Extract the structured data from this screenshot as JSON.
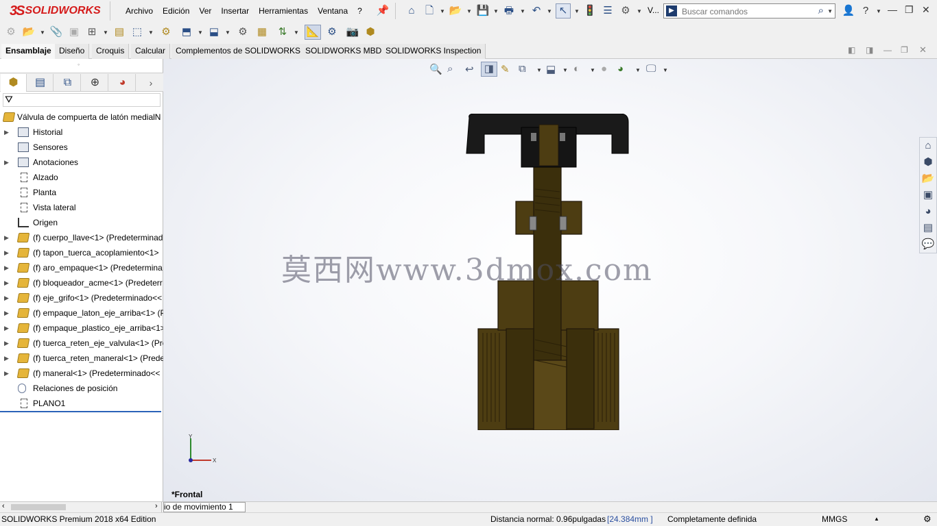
{
  "app": {
    "logo_ds": "3S",
    "logo_text": "SOLIDWORKS",
    "menu": [
      "Archivo",
      "Edición",
      "Ver",
      "Insertar",
      "Herramientas",
      "Ventana",
      "?"
    ],
    "view_menu_short": "V...",
    "search_placeholder": "Buscar comandos"
  },
  "tabs": [
    "Ensamblaje",
    "Diseño",
    "Croquis",
    "Calcular",
    "Complementos de SOLIDWORKS",
    "SOLIDWORKS MBD",
    "SOLIDWORKS Inspection"
  ],
  "active_tab": "Ensamblaje",
  "tree": {
    "root": "Válvula de compuerta de latón medialN",
    "items": [
      {
        "label": "Historial",
        "icon": "history-folder-icon",
        "expandable": true
      },
      {
        "label": "Sensores",
        "icon": "sensor-folder-icon",
        "expandable": false
      },
      {
        "label": "Anotaciones",
        "icon": "annotations-icon",
        "expandable": true
      },
      {
        "label": "Alzado",
        "icon": "plane-icon",
        "expandable": false
      },
      {
        "label": "Planta",
        "icon": "plane-icon",
        "expandable": false
      },
      {
        "label": "Vista lateral",
        "icon": "plane-icon",
        "expandable": false
      },
      {
        "label": "Origen",
        "icon": "origin-icon",
        "expandable": false
      },
      {
        "label": "(f) cuerpo_llave<1> (Predeterminad",
        "icon": "part-icon",
        "expandable": true
      },
      {
        "label": "(f) tapon_tuerca_acoplamiento<1>",
        "icon": "part-icon",
        "expandable": true
      },
      {
        "label": "(f) aro_empaque<1> (Predetermina",
        "icon": "part-icon",
        "expandable": true
      },
      {
        "label": "(f) bloqueador_acme<1> (Predeterr",
        "icon": "part-icon",
        "expandable": true
      },
      {
        "label": "(f) eje_grifo<1> (Predeterminado<<",
        "icon": "part-icon",
        "expandable": true
      },
      {
        "label": "(f) empaque_laton_eje_arriba<1> (P",
        "icon": "part-icon",
        "expandable": true
      },
      {
        "label": "(f) empaque_plastico_eje_arriba<1>",
        "icon": "part-icon",
        "expandable": true
      },
      {
        "label": "(f) tuerca_reten_eje_valvula<1> (Pre",
        "icon": "part-icon",
        "expandable": true
      },
      {
        "label": "(f) tuerca_reten_maneral<1> (Prede",
        "icon": "part-icon",
        "expandable": true
      },
      {
        "label": "(f) maneral<1> (Predeterminado<<",
        "icon": "part-icon",
        "expandable": true
      },
      {
        "label": "Relaciones de posición",
        "icon": "mates-icon",
        "expandable": false
      },
      {
        "label": "PLANO1",
        "icon": "plane-icon",
        "expandable": false
      }
    ]
  },
  "viewport": {
    "watermark": "莫西网www.3dmox.com",
    "view_name": "*Frontal",
    "triad_y": "Y",
    "triad_x": "X"
  },
  "bottom_tab": "io de movimiento 1",
  "status": {
    "edition": "SOLIDWORKS Premium 2018 x64 Edition",
    "distance_label": "Distancia normal: 0.96pulgadas",
    "distance_mm": "[24.384mm ]",
    "definition": "Completamente definida",
    "units": "MMGS"
  },
  "colors": {
    "brass": "#4a3a12",
    "handle": "#1a1a1a",
    "logo_red": "#d51b1b",
    "tree_selection": "#2a62b8"
  }
}
